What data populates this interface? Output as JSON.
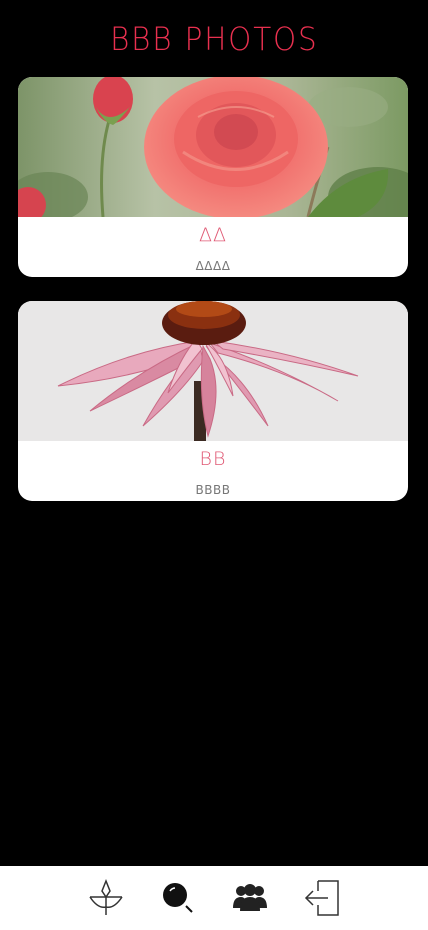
{
  "app": {
    "title": "BBB PHOTOS",
    "accent_color": "#e8304f"
  },
  "photos": [
    {
      "title": "ΔΔ",
      "subtitle": "ΔΔΔΔ",
      "image": "pink-rose"
    },
    {
      "title": "BB",
      "subtitle": "BBBB",
      "image": "pink-coneflower"
    }
  ],
  "bottom_nav": [
    {
      "icon": "plant-icon"
    },
    {
      "icon": "search-icon"
    },
    {
      "icon": "group-icon"
    },
    {
      "icon": "logout-icon"
    }
  ]
}
